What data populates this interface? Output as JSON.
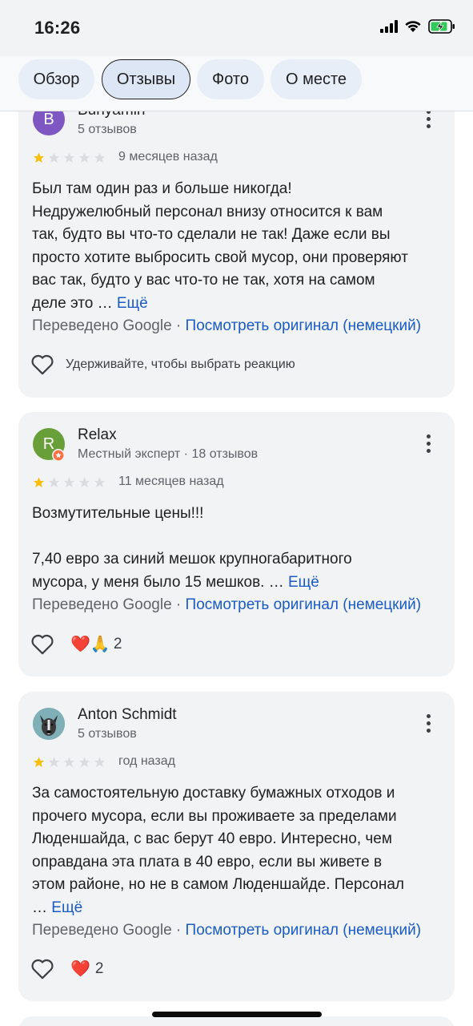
{
  "status_bar": {
    "time": "16:26"
  },
  "tabs": [
    {
      "label": "Обзор",
      "active": false
    },
    {
      "label": "Отзывы",
      "active": true
    },
    {
      "label": "Фото",
      "active": false
    },
    {
      "label": "О месте",
      "active": false
    }
  ],
  "reviews": [
    {
      "author": "Bunyamin",
      "avatar_letter": "B",
      "avatar_color": "#7e57c2",
      "meta": "5 отзывов",
      "rating": 1,
      "date": "9 месяцев назад",
      "text_lines": [
        "Был там один раз и больше никогда!",
        "Недружелюбный персонал внизу относится к вам",
        "так, будто вы что-то сделали не так! Даже если вы",
        "просто хотите выбросить свой мусор, они проверяют",
        "вас так, будто у вас что-то не так, хотя на самом",
        "деле это …"
      ],
      "more_label": "Ещё",
      "translated_label": "Переведено Google",
      "original_link": "Посмотреть оригинал (немецкий)",
      "react_hint": "Удерживайте, чтобы выбрать реакцию"
    },
    {
      "author": "Relax",
      "avatar_letter": "R",
      "avatar_color": "#689f38",
      "meta": "Местный эксперт · 18 отзывов",
      "rating": 1,
      "date": "11 месяцев назад",
      "text_lines": [
        "Возмутительные цены!!!",
        "",
        "7,40 евро за синий мешок крупногабаритного",
        "мусора, у меня было 15 мешков. …"
      ],
      "more_label": "Ещё",
      "translated_label": "Переведено Google",
      "original_link": "Посмотреть оригинал (немецкий)",
      "reactions_emoji": "❤️🙏",
      "reactions_count": "2"
    },
    {
      "author": "Anton Schmidt",
      "meta": "5 отзывов",
      "rating": 1,
      "date": "год назад",
      "text_lines": [
        "За самостоятельную доставку бумажных отходов и",
        "прочего мусора, если вы проживаете за пределами",
        "Люденшайда, с вас берут 40 евро. Интересно, чем",
        "оправдана эта плата в 40 евро, если вы живете в",
        "этом районе, но не в самом Люденшайде. Персонал",
        "…"
      ],
      "more_label": "Ещё",
      "translated_label": "Переведено Google",
      "original_link": "Посмотреть оригинал (немецкий)",
      "reactions_emoji": "❤️",
      "reactions_count": "2"
    }
  ],
  "colors": {
    "star_filled": "#fbbc04",
    "star_empty": "#dadce0",
    "link": "#1a5bc4",
    "card_bg": "#f1f3f4"
  }
}
